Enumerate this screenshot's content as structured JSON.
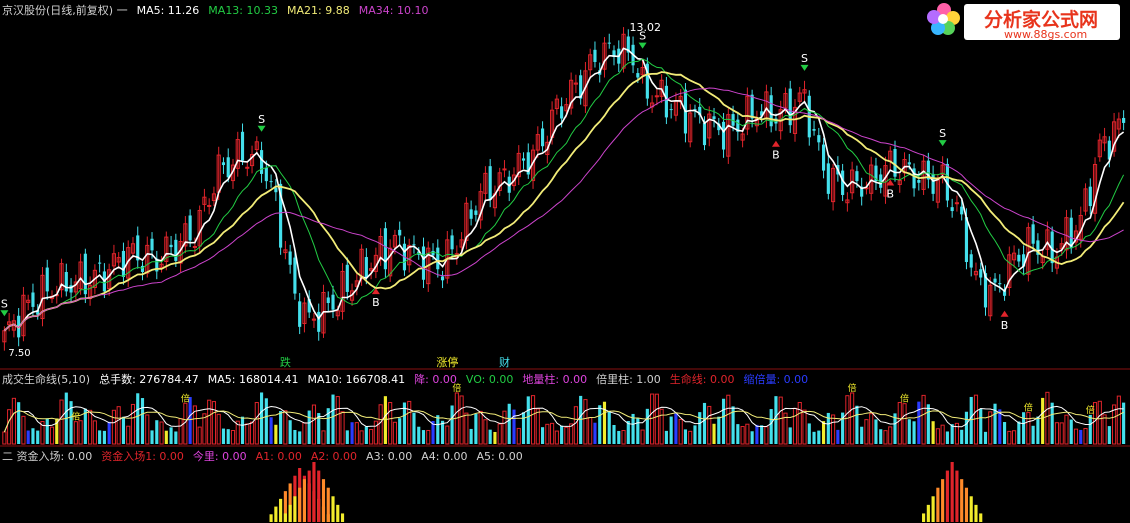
{
  "colors": {
    "bg": "#000000",
    "up": "#e0242b",
    "down": "#44e0ec",
    "ma5": "#ffffff",
    "ma13": "#22cc44",
    "ma21": "#f2ec78",
    "ma34": "#cc44cc",
    "divider": "#5a0a0a",
    "yellow": "#f2ec2c",
    "blue": "#2a3cff",
    "magenta": "#dd44dd"
  },
  "main_header": [
    {
      "text": "京汉股份(日线,前复权) 一",
      "color": "#d0d0d0"
    },
    {
      "text": "MA5: 11.26",
      "color": "#ffffff"
    },
    {
      "text": "MA13: 10.33",
      "color": "#22cc44"
    },
    {
      "text": "MA21: 9.88",
      "color": "#f2ec78"
    },
    {
      "text": "MA34: 10.10",
      "color": "#cc44cc"
    }
  ],
  "volume_header": [
    {
      "text": "成交生命线(5,10)",
      "color": "#d0d0d0"
    },
    {
      "text": "总手数: 276784.47",
      "color": "#ffffff"
    },
    {
      "text": "MA5: 168014.41",
      "color": "#ffffff"
    },
    {
      "text": "MA10: 166708.41",
      "color": "#ffffff"
    },
    {
      "text": "降: 0.00",
      "color": "#dd44dd"
    },
    {
      "text": "VO: 0.00",
      "color": "#22cc44"
    },
    {
      "text": "地量柱: 0.00",
      "color": "#dd44dd"
    },
    {
      "text": "倍里柱: 1.00",
      "color": "#d0d0d0"
    },
    {
      "text": "生命线: 0.00",
      "color": "#e0242b"
    },
    {
      "text": "缩倍量: 0.00",
      "color": "#2a3cff"
    }
  ],
  "fund_header": [
    {
      "text": "二 资金入场: 0.00",
      "color": "#d0d0d0"
    },
    {
      "text": "资金入场1: 0.00",
      "color": "#e0242b"
    },
    {
      "text": "今里: 0.00",
      "color": "#dd44dd"
    },
    {
      "text": "A1: 0.00",
      "color": "#e0242b"
    },
    {
      "text": "A2: 0.00",
      "color": "#e0242b"
    },
    {
      "text": "A3: 0.00",
      "color": "#d0d0d0"
    },
    {
      "text": "A4: 0.00",
      "color": "#d0d0d0"
    },
    {
      "text": "A5: 0.00",
      "color": "#d0d0d0"
    }
  ],
  "logo": {
    "title": "分析家公式网",
    "url": "www.88gs.com"
  },
  "price_labels": {
    "high": "13.02",
    "low": "7.50"
  },
  "event_labels": [
    {
      "text": "跌",
      "color": "#22cc44",
      "idx": 59
    },
    {
      "text": "涨停",
      "color": "#f2ec2c",
      "idx": 93
    },
    {
      "text": "财",
      "color": "#44e0ec",
      "idx": 105
    }
  ],
  "chart_data": {
    "type": "candlestick",
    "ylim": [
      7.3,
      13.4
    ],
    "vol_ylim": [
      0,
      300000
    ],
    "candles": [],
    "signals_S": [
      0,
      54,
      134,
      168,
      197
    ],
    "signals_B": [
      78,
      162,
      186,
      210
    ],
    "vol_marker_text": "倍",
    "vol_markers": [
      15,
      38,
      95,
      178,
      189,
      215,
      228
    ],
    "fund_spikes": [
      {
        "idx": 62,
        "value": 0.9
      },
      {
        "idx": 65,
        "value": 1.0
      },
      {
        "idx": 199,
        "value": 1.0
      }
    ]
  }
}
